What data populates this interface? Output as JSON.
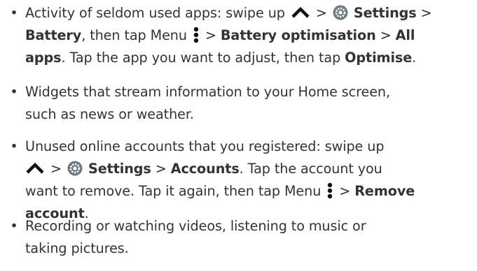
{
  "bullet": "•",
  "items": [
    {
      "lines": [
        [
          "Activity of seldom used apps: swipe up",
          "Settings",
          " > "
        ],
        [
          "Battery",
          ", then tap Menu",
          " > ",
          "Battery optimisation",
          " > ",
          "All"
        ],
        [
          "apps",
          ". Tap the app you want to adjust, then tap ",
          "Optimise",
          "."
        ]
      ],
      "sep": " > "
    },
    {
      "lines": [
        [
          "Widgets that stream information to your Home screen,"
        ],
        [
          "such as news or weather."
        ]
      ]
    },
    {
      "lines": [
        [
          "Unused online accounts that you registered: swipe up"
        ],
        [
          " > ",
          "Settings",
          " > ",
          "Accounts",
          ". Tap the account you"
        ],
        [
          "want to remove. Tap it again, then tap Menu",
          " > ",
          "Remove"
        ],
        [
          "account",
          "."
        ]
      ]
    },
    {
      "lines": [
        [
          "Recording or watching videos, listening to music or"
        ],
        [
          "taking pictures."
        ]
      ]
    }
  ],
  "icons": {
    "up": "chevron-up-icon",
    "gear": "settings-gear-icon",
    "menu": "vertical-dots-menu-icon"
  },
  "colors": {
    "text": "#333333",
    "gear_bg": "#6b7a82",
    "gear_fg": "#ffffff"
  }
}
